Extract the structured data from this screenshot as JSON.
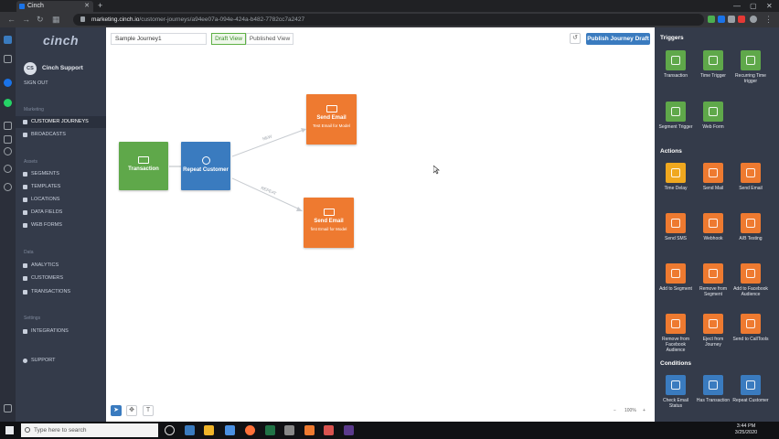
{
  "browser": {
    "tab_title": "Cinch",
    "url_host": "marketing.cinch.io",
    "url_path": "/customer-journeys/a94ee07a-094e-424a-b482-7782cc7a2427"
  },
  "sidebar": {
    "logo": "cinch",
    "avatar_initials": "CS",
    "user_name": "Cinch Support",
    "sign_out": "SIGN OUT",
    "sections": {
      "marketing": "Marketing",
      "assets": "Assets",
      "data": "Data",
      "settings": "Settings"
    },
    "marketing_items": [
      "CUSTOMER JOURNEYS",
      "BROADCASTS"
    ],
    "asset_items": [
      "SEGMENTS",
      "TEMPLATES",
      "LOCATIONS",
      "DATA FIELDS",
      "WEB FORMS"
    ],
    "data_items": [
      "ANALYTICS",
      "CUSTOMERS",
      "TRANSACTIONS"
    ],
    "settings_items": [
      "INTEGRATIONS"
    ],
    "support": "SUPPORT"
  },
  "toolbar": {
    "journey_name": "Sample Journey1",
    "draft_view": "Draft View",
    "published_view": "Published View",
    "undo_icon": "↺",
    "publish_label": "Publish Journey Draft"
  },
  "nodes": {
    "transaction": "Transaction",
    "repeat_customer": "Repeat Customer",
    "email1_title": "Send Email",
    "email1_sub": "Test Email for Model",
    "email2_title": "Send Email",
    "email2_sub": "first Email for Model"
  },
  "edges": {
    "new_label": "NEW",
    "repeat_label": "REPEAT"
  },
  "zoom": {
    "minus": "−",
    "value": "100%",
    "plus": "+"
  },
  "panel": {
    "triggers_heading": "Triggers",
    "triggers": [
      {
        "label": "Transaction",
        "color": "#5fa84a"
      },
      {
        "label": "Time Trigger",
        "color": "#5fa84a"
      },
      {
        "label": "Recurring Time trigger",
        "color": "#5fa84a"
      },
      {
        "label": "Segment Trigger",
        "color": "#5fa84a"
      },
      {
        "label": "Web Form",
        "color": "#5fa84a"
      }
    ],
    "actions_heading": "Actions",
    "actions": [
      {
        "label": "Time Delay",
        "color": "#f0a81f"
      },
      {
        "label": "Send Mail",
        "color": "#ee7a30"
      },
      {
        "label": "Send Email",
        "color": "#ee7a30"
      },
      {
        "label": "Send SMS",
        "color": "#ee7a30"
      },
      {
        "label": "Webhook",
        "color": "#ee7a30"
      },
      {
        "label": "A/B Testing",
        "color": "#ee7a30"
      },
      {
        "label": "Add to Segment",
        "color": "#ee7a30"
      },
      {
        "label": "Remove from Segment",
        "color": "#ee7a30"
      },
      {
        "label": "Add to Facebook Audience",
        "color": "#ee7a30"
      },
      {
        "label": "Remove from Facebook Audience",
        "color": "#ee7a30"
      },
      {
        "label": "Eject from Journey",
        "color": "#ee7a30"
      },
      {
        "label": "Send to CallTools",
        "color": "#ee7a30"
      }
    ],
    "conditions_heading": "Conditions",
    "conditions": [
      {
        "label": "Check Email Status",
        "color": "#3a7bbf"
      },
      {
        "label": "Has Transaction",
        "color": "#3a7bbf"
      },
      {
        "label": "Repeat Customer",
        "color": "#3a7bbf"
      }
    ]
  },
  "taskbar": {
    "search_placeholder": "Type here to search",
    "time": "3:44 PM",
    "date": "3/25/2020"
  },
  "colors": {
    "trigger_green": "#5fa84a",
    "condition_blue": "#3a7bbf",
    "action_orange": "#ee7a30"
  }
}
